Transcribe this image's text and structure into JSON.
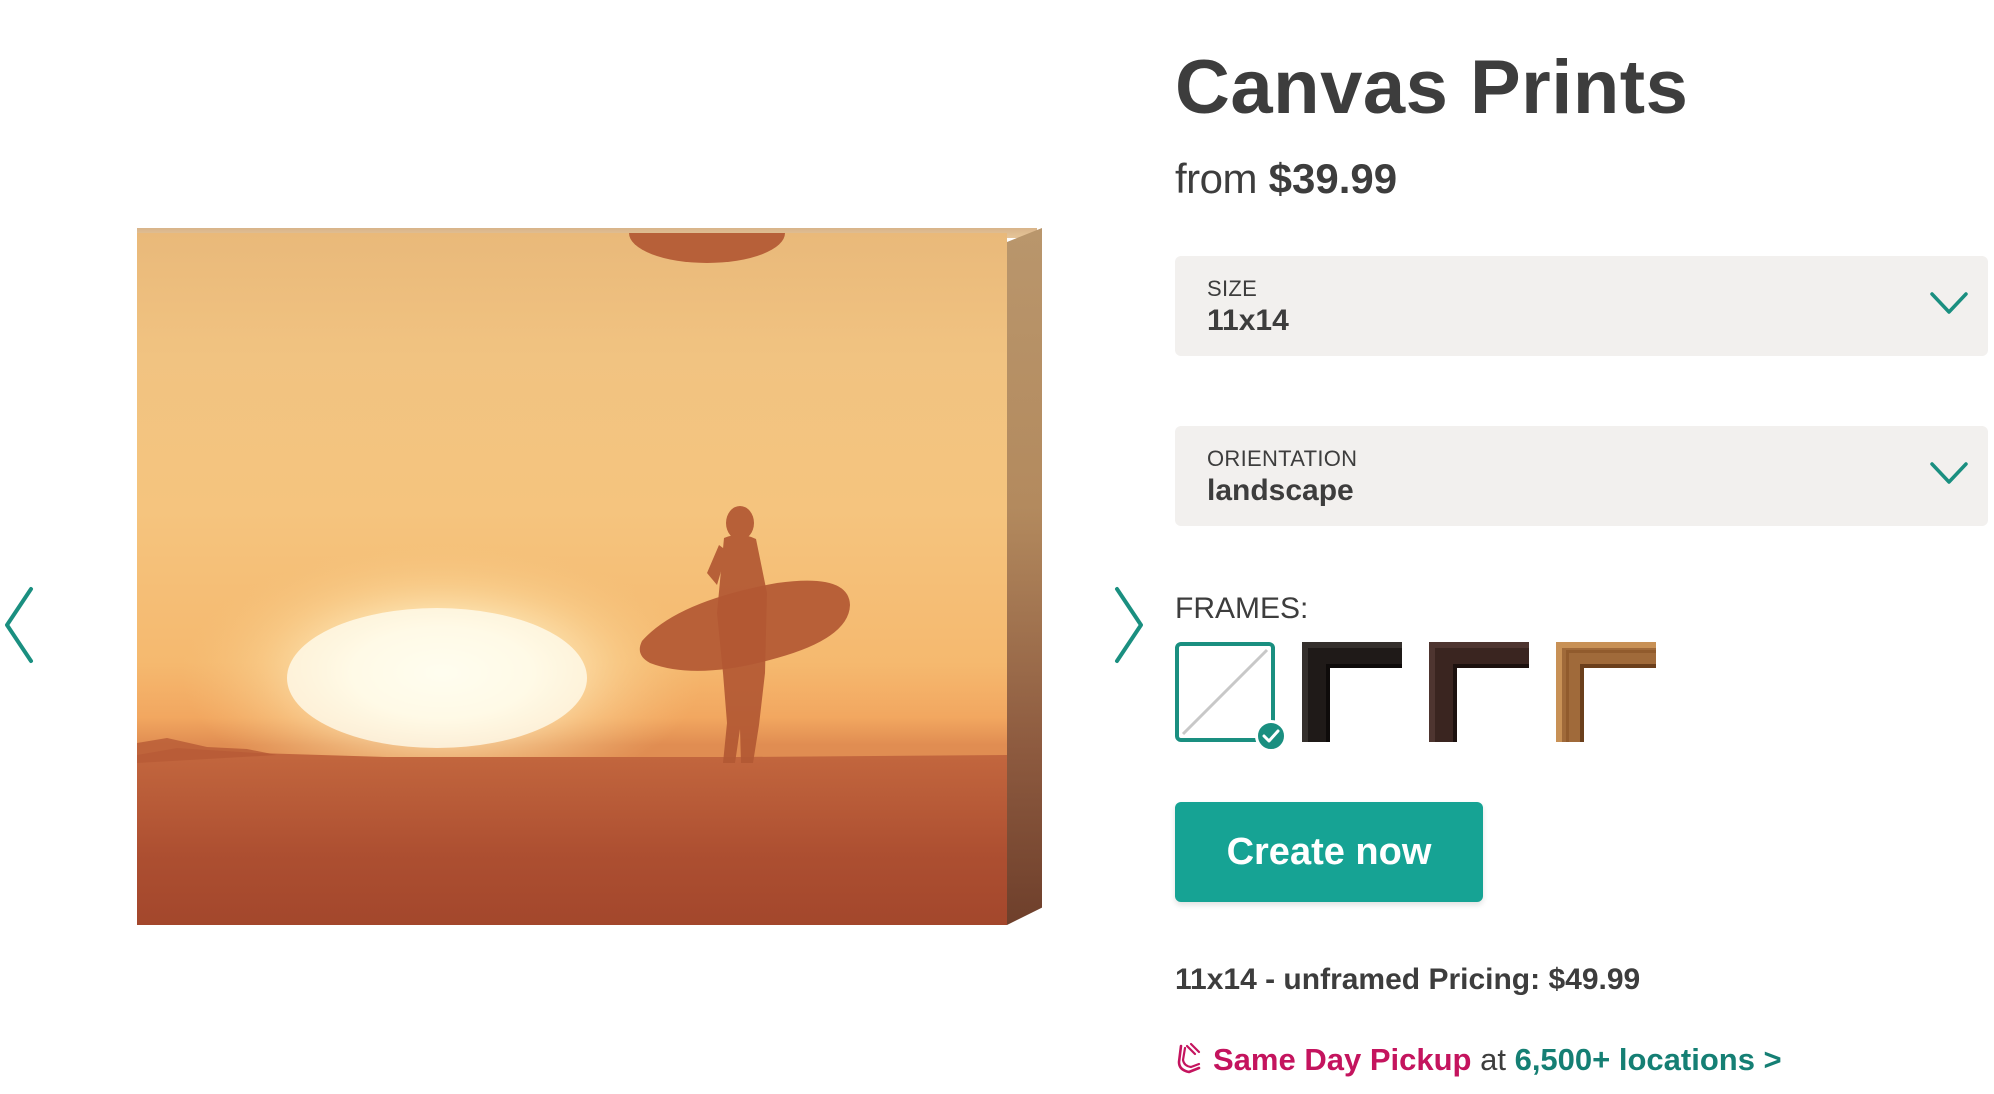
{
  "product": {
    "title": "Canvas Prints",
    "price_prefix": "from",
    "price": "$39.99"
  },
  "size_select": {
    "label": "SIZE",
    "value": "11x14"
  },
  "orientation_select": {
    "label": "ORIENTATION",
    "value": "landscape"
  },
  "frames": {
    "label": "FRAMES:",
    "options": [
      "none",
      "black",
      "espresso",
      "oak"
    ],
    "selected": "none"
  },
  "cta": {
    "label": "Create now"
  },
  "pricing": {
    "text": "11x14 - unframed Pricing: $49.99"
  },
  "pickup": {
    "title": "Same Day Pickup",
    "connector": "at",
    "link": "6,500+ locations >"
  },
  "colors": {
    "accent": "#16a394",
    "pickup_pink": "#c4145e",
    "link_teal": "#157f74",
    "text": "#3d3d3d",
    "select_bg": "#f2f0ee"
  },
  "icons": {
    "gallery_prev": "chevron-left-icon",
    "gallery_next": "chevron-right-icon",
    "select": "chevron-down-icon",
    "selected": "check-icon",
    "pickup": "pickup-bag-icon"
  }
}
